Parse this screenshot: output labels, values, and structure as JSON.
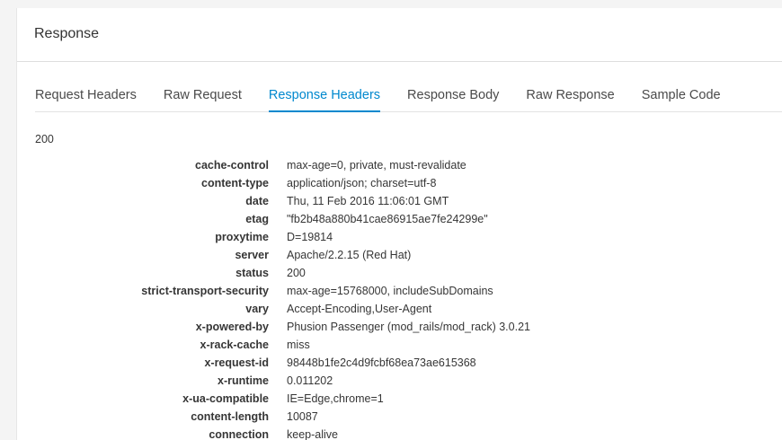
{
  "panel": {
    "title": "Response"
  },
  "tabs": [
    {
      "label": "Request Headers",
      "active": false
    },
    {
      "label": "Raw Request",
      "active": false
    },
    {
      "label": "Response Headers",
      "active": true
    },
    {
      "label": "Response Body",
      "active": false
    },
    {
      "label": "Raw Response",
      "active": false
    },
    {
      "label": "Sample Code",
      "active": false
    }
  ],
  "response": {
    "status_code": "200",
    "headers": [
      {
        "key": "cache-control",
        "value": "max-age=0, private, must-revalidate"
      },
      {
        "key": "content-type",
        "value": "application/json; charset=utf-8"
      },
      {
        "key": "date",
        "value": "Thu, 11 Feb 2016 11:06:01 GMT"
      },
      {
        "key": "etag",
        "value": "\"fb2b48a880b41cae86915ae7fe24299e\""
      },
      {
        "key": "proxytime",
        "value": "D=19814"
      },
      {
        "key": "server",
        "value": "Apache/2.2.15 (Red Hat)"
      },
      {
        "key": "status",
        "value": "200"
      },
      {
        "key": "strict-transport-security",
        "value": "max-age=15768000, includeSubDomains"
      },
      {
        "key": "vary",
        "value": "Accept-Encoding,User-Agent"
      },
      {
        "key": "x-powered-by",
        "value": "Phusion Passenger (mod_rails/mod_rack) 3.0.21"
      },
      {
        "key": "x-rack-cache",
        "value": "miss"
      },
      {
        "key": "x-request-id",
        "value": "98448b1fe2c4d9fcbf68ea73ae615368"
      },
      {
        "key": "x-runtime",
        "value": "0.011202"
      },
      {
        "key": "x-ua-compatible",
        "value": "IE=Edge,chrome=1"
      },
      {
        "key": "content-length",
        "value": "10087"
      },
      {
        "key": "connection",
        "value": "keep-alive"
      }
    ]
  },
  "colors": {
    "accent": "#0088ce",
    "text": "#363636",
    "background": "#f4f4f4",
    "panel": "#ffffff"
  }
}
